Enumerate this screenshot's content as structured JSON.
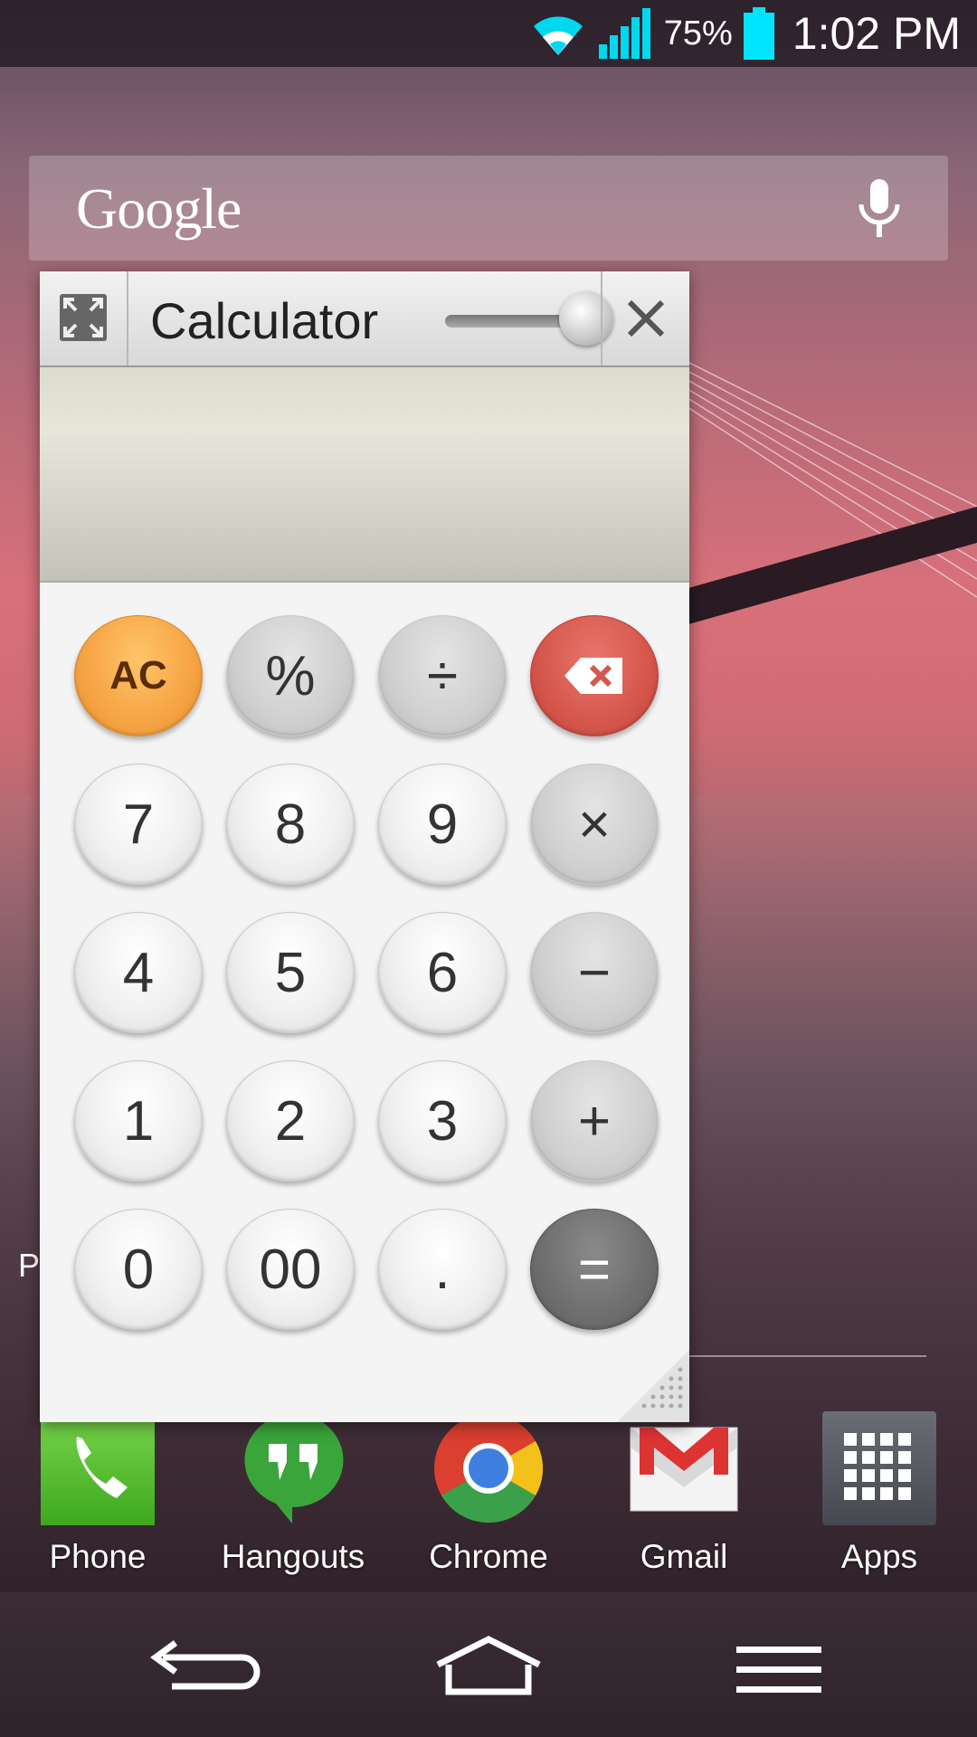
{
  "status_bar": {
    "battery": "75%",
    "time": "1:02 PM"
  },
  "search": {
    "logo": "Google"
  },
  "home": {
    "page_letter": "P"
  },
  "calculator": {
    "title": "Calculator",
    "display": "",
    "keys": [
      {
        "label": "AC",
        "kind": "ac",
        "name": "key-all-clear"
      },
      {
        "label": "%",
        "kind": "op",
        "name": "key-percent"
      },
      {
        "label": "÷",
        "kind": "op",
        "name": "key-divide"
      },
      {
        "label": "",
        "kind": "del",
        "name": "key-backspace"
      },
      {
        "label": "7",
        "kind": "num",
        "name": "key-7"
      },
      {
        "label": "8",
        "kind": "num",
        "name": "key-8"
      },
      {
        "label": "9",
        "kind": "num",
        "name": "key-9"
      },
      {
        "label": "×",
        "kind": "op",
        "name": "key-multiply"
      },
      {
        "label": "4",
        "kind": "num",
        "name": "key-4"
      },
      {
        "label": "5",
        "kind": "num",
        "name": "key-5"
      },
      {
        "label": "6",
        "kind": "num",
        "name": "key-6"
      },
      {
        "label": "−",
        "kind": "op",
        "name": "key-subtract"
      },
      {
        "label": "1",
        "kind": "num",
        "name": "key-1"
      },
      {
        "label": "2",
        "kind": "num",
        "name": "key-2"
      },
      {
        "label": "3",
        "kind": "num",
        "name": "key-3"
      },
      {
        "label": "+",
        "kind": "op",
        "name": "key-add"
      },
      {
        "label": "0",
        "kind": "num",
        "name": "key-0"
      },
      {
        "label": "00",
        "kind": "num",
        "name": "key-00"
      },
      {
        "label": ".",
        "kind": "num",
        "name": "key-decimal"
      },
      {
        "label": "=",
        "kind": "eq",
        "name": "key-equals"
      }
    ]
  },
  "dock": {
    "items": [
      {
        "label": "Phone",
        "icon": "phone-icon"
      },
      {
        "label": "Hangouts",
        "icon": "hangouts-icon"
      },
      {
        "label": "Chrome",
        "icon": "chrome-icon"
      },
      {
        "label": "Gmail",
        "icon": "gmail-icon"
      },
      {
        "label": "Apps",
        "icon": "apps-grid-icon"
      }
    ]
  },
  "colors": {
    "ac_key": "#f6a444",
    "delete_key": "#d6574c",
    "equals_key": "#6e6e6e",
    "battery": "#00e5ff"
  }
}
